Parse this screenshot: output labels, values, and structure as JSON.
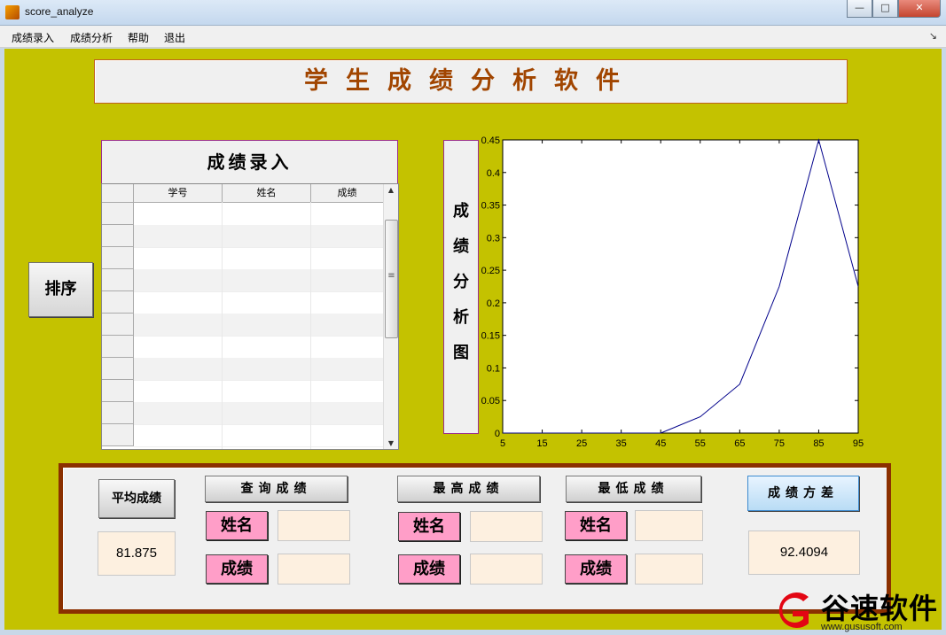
{
  "window": {
    "title": "score_analyze",
    "min": "—",
    "max": "□",
    "close": "✕"
  },
  "menu": {
    "items": [
      "成绩录入",
      "成绩分析",
      "帮助",
      "退出"
    ],
    "toolbar_arrow": "↘"
  },
  "header": {
    "title": "学生成绩分析软件"
  },
  "entry": {
    "title": "成绩录入",
    "columns": [
      "学号",
      "姓名",
      "成绩"
    ],
    "scroll_grip": "≡",
    "scroll_up": "▲",
    "scroll_down": "▼"
  },
  "sort_button": "排序",
  "plot_label": [
    "成",
    "绩",
    "分",
    "析",
    "图"
  ],
  "chart_data": {
    "type": "line",
    "x": [
      5,
      15,
      25,
      35,
      45,
      55,
      65,
      75,
      85,
      95
    ],
    "series": [
      {
        "values": [
          0,
          0,
          0,
          0,
          0,
          0.025,
          0.075,
          0.225,
          0.45,
          0.225
        ],
        "color": "#00008b"
      }
    ],
    "xticks": [
      5,
      15,
      25,
      35,
      45,
      55,
      65,
      75,
      85,
      95
    ],
    "yticks": [
      0,
      0.05,
      0.1,
      0.15,
      0.2,
      0.25,
      0.3,
      0.35,
      0.4,
      0.45
    ],
    "xlim": [
      5,
      95
    ],
    "ylim": [
      0,
      0.45
    ],
    "grid": false
  },
  "stats": {
    "average_button": "平均成绩",
    "average_value": "81.875",
    "query_button": "查询成绩",
    "max_button": "最高成绩",
    "min_button": "最低成绩",
    "variance_button": "成绩方差",
    "variance_value": "92.4094",
    "name_label": "姓名",
    "score_label": "成绩"
  },
  "watermark": {
    "brand": "谷速软件",
    "url": "www.gususoft.com"
  }
}
